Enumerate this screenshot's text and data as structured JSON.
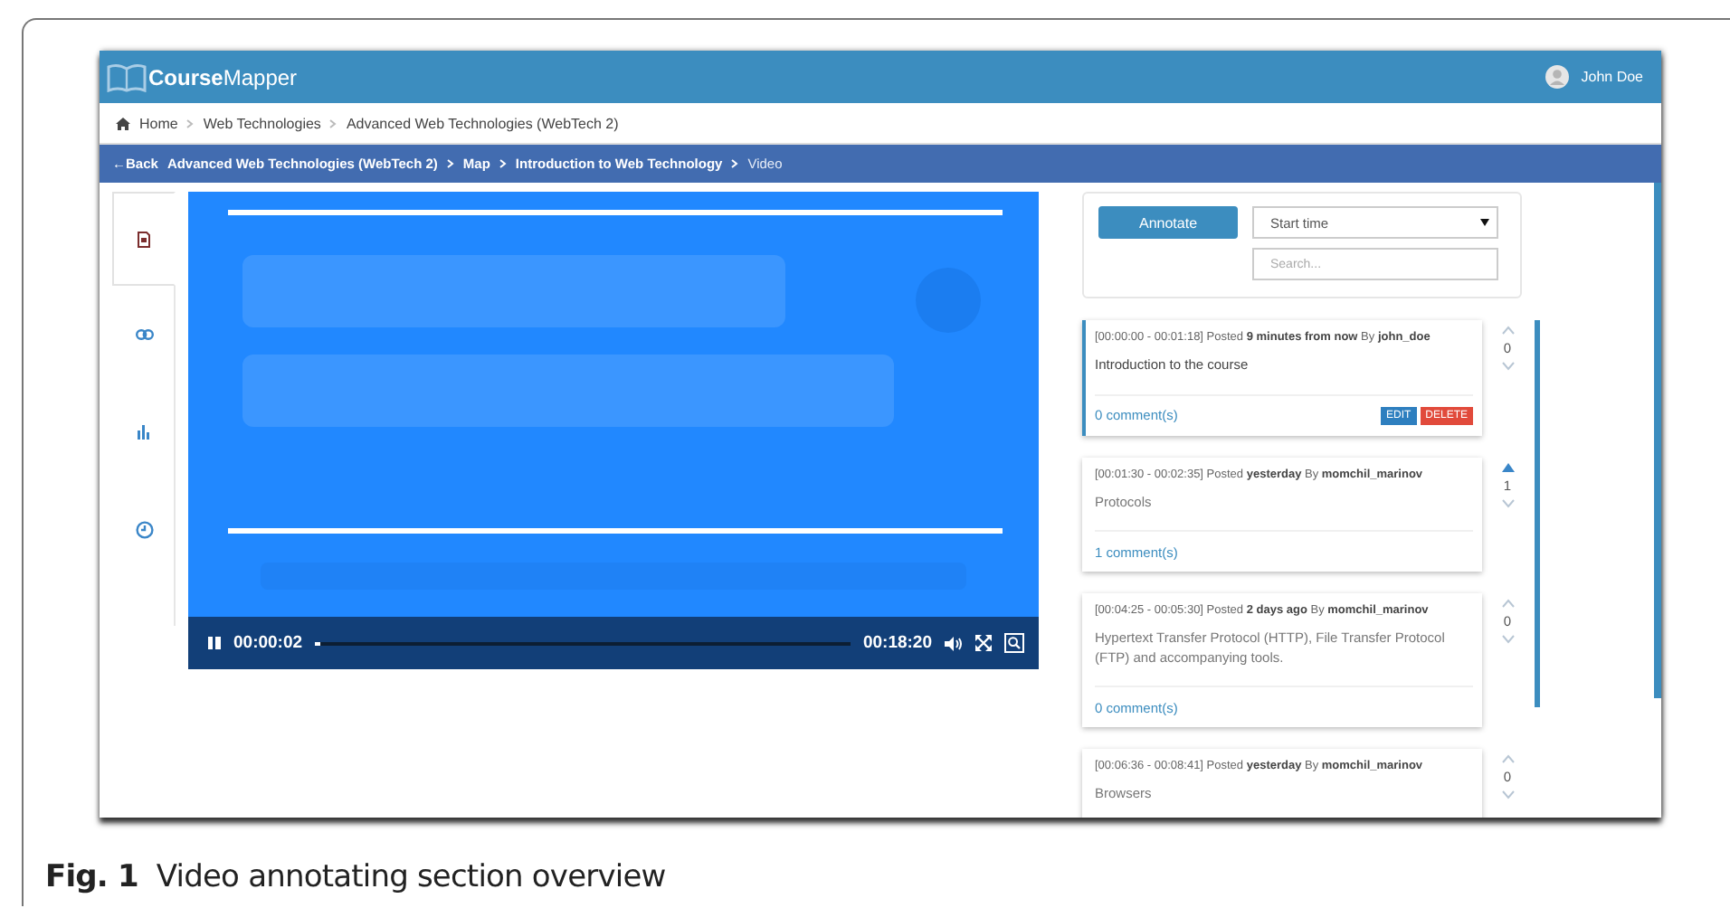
{
  "header": {
    "logo_bold": "Course",
    "logo_rest": "Mapper",
    "user": "John Doe"
  },
  "breadcrumb": [
    "Home",
    "Web Technologies",
    "Advanced Web Technologies (WebTech 2)"
  ],
  "nav": {
    "back": "←Back",
    "path": [
      "Advanced Web Technologies (WebTech 2)",
      "Map",
      "Introduction to Web Technology"
    ],
    "current": "Video"
  },
  "sidebar_tabs": [
    {
      "kind": "document",
      "selected": true
    },
    {
      "kind": "link",
      "selected": false
    },
    {
      "kind": "chart",
      "selected": false
    },
    {
      "kind": "clock",
      "selected": false
    }
  ],
  "player": {
    "playing": true,
    "current_time": "00:00:02",
    "duration": "00:18:20",
    "level": 0.01
  },
  "annotate": {
    "button": "Annotate",
    "sort": "Start time",
    "search_placeholder": "Search..."
  },
  "annotations": [
    {
      "header": "[00:00:00 - 00:01:18] Posted **9 minutes from now** By **john_doe**",
      "text": "Introduction to the course",
      "comments": "0 comment(s)",
      "votes": "0",
      "voted": false,
      "selected": true,
      "actions": [
        "EDIT",
        "DELETE"
      ]
    },
    {
      "header": "[00:01:30 - 00:02:35] Posted **yesterday** By **momchil_marinov**",
      "text": "Protocols",
      "comments": "1 comment(s)",
      "votes": "1",
      "voted": true,
      "selected": false
    },
    {
      "header": "[00:04:25 - 00:05:30] Posted **2 days ago** By **momchil_marinov**",
      "text": "Hypertext Transfer Protocol (HTTP), File Transfer Protocol (FTP) and accompanying tools.",
      "comments": "0 comment(s)",
      "votes": "0",
      "voted": false,
      "selected": false
    },
    {
      "header": "[00:06:36 - 00:08:41] Posted **yesterday** By **momchil_marinov**",
      "text": "Browsers",
      "votes": "0",
      "voted": false,
      "selected": false
    }
  ],
  "caption": {
    "label": "Fig. 1",
    "text": "Video annotating section overview"
  }
}
